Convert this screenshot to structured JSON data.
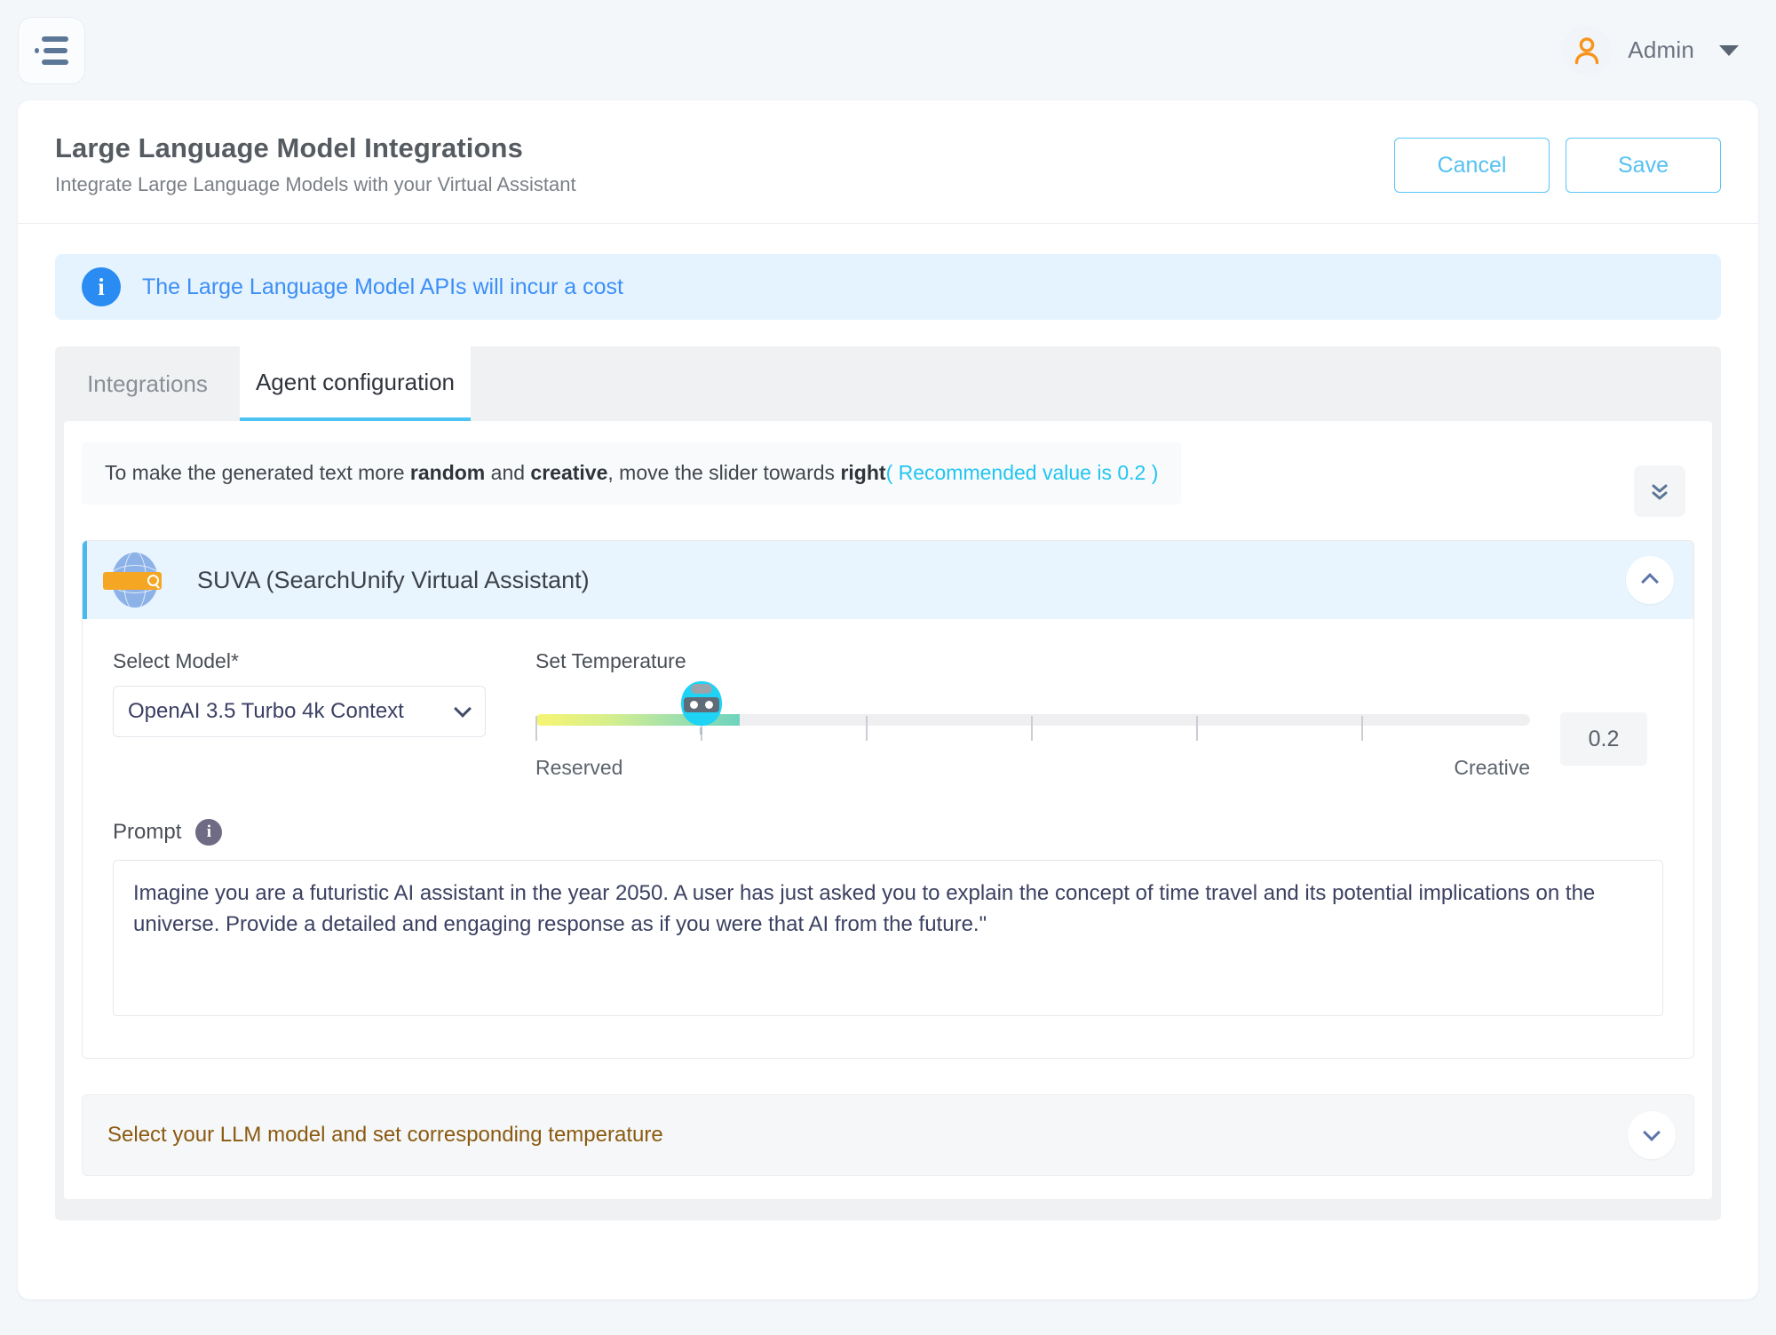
{
  "topbar": {
    "menu_icon": "hamburger-list-icon",
    "user_icon": "person-icon",
    "user_name": "Admin",
    "caret_icon": "chevron-down-icon"
  },
  "page": {
    "title": "Large Language Model Integrations",
    "subtitle": "Integrate Large Language Models with your Virtual Assistant",
    "cancel_label": "Cancel",
    "save_label": "Save"
  },
  "banner": {
    "icon": "info-icon",
    "text": "The Large Language Model APIs will incur a cost"
  },
  "tabs": [
    {
      "label": "Integrations",
      "active": false
    },
    {
      "label": "Agent configuration",
      "active": true
    }
  ],
  "hint": {
    "part1": "To make the generated text more ",
    "bold1": "random",
    "part2": " and ",
    "bold2": "creative",
    "part3": ", move the slider towards ",
    "bold3": "right",
    "recommended": "( Recommended value is 0.2 )",
    "expand_all_icon": "double-chevron-down-icon"
  },
  "accordion": {
    "logo": "suva-globe-search-icon",
    "title": "SUVA (SearchUnify Virtual Assistant)",
    "toggle_icon": "chevron-up-icon",
    "model": {
      "label": "Select Model*",
      "value": "OpenAI 3.5 Turbo 4k Context",
      "chevron_icon": "chevron-down-icon"
    },
    "temperature": {
      "label": "Set Temperature",
      "min_label": "Reserved",
      "max_label": "Creative",
      "value": "0.2",
      "thumb_icon": "robot-head-icon"
    },
    "prompt": {
      "label": "Prompt",
      "info_icon": "info-icon",
      "value": "Imagine you are a futuristic AI assistant in the year 2050. A user has just asked you to explain the concept of time travel and its potential implications on the universe. Provide a detailed and engaging response as if you were that AI from the future.\""
    }
  },
  "collapsed_section": {
    "text": "Select your LLM model and set corresponding temperature",
    "toggle_icon": "chevron-down-icon"
  },
  "colors": {
    "accent_blue": "#4cc3f5",
    "banner_blue": "#3d8ef6",
    "cyan": "#22c5f2",
    "orange": "#f5a623",
    "brown": "#8a5a10"
  }
}
